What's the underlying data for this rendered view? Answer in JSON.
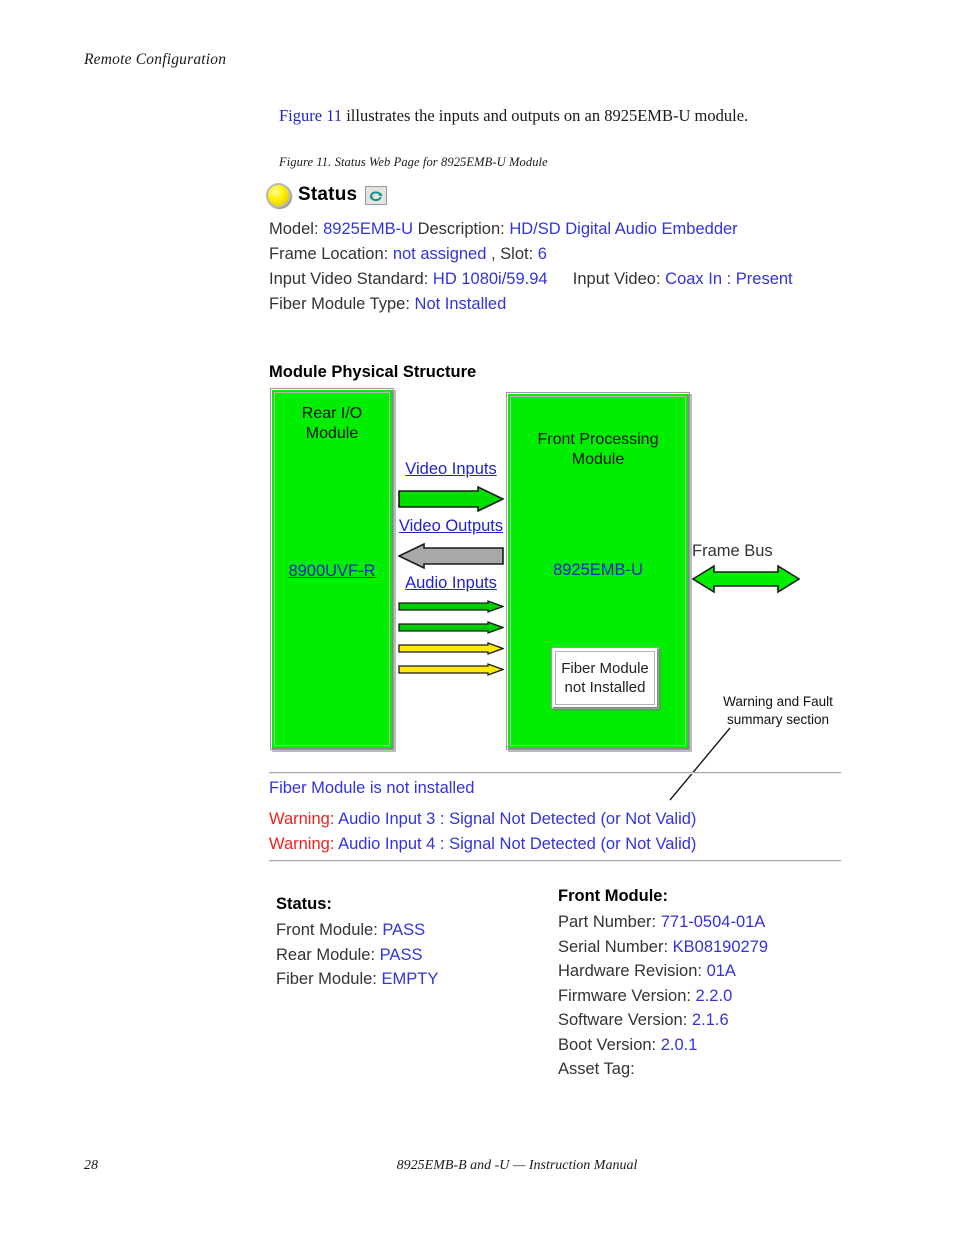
{
  "page": {
    "running_head": "Remote Configuration",
    "body_paragraph_prefix": "Figure 11",
    "body_paragraph_rest": " illustrates the inputs and outputs on an 8925EMB-U module.",
    "figure_caption": "Figure 11.  Status Web Page for 8925EMB-U Module",
    "folio": "28",
    "footer_title": "8925EMB-B and -U — Instruction Manual"
  },
  "status_panel": {
    "led_icon": "yellow-led-icon",
    "heading": "Status",
    "refresh_icon": "refresh-icon",
    "fields": [
      {
        "label": "Model:",
        "value": "8925EMB-U",
        "label2": "Description:",
        "value2": "HD/SD Digital Audio Embedder"
      },
      {
        "label": "Frame Location:",
        "value": "not assigned",
        "label2": ", Slot:",
        "value2": "6"
      },
      {
        "label": "Input Video Standard:",
        "value": "HD 1080i/59.94",
        "label2": "Input Video:",
        "value2": "Coax In : Present"
      },
      {
        "label": "Fiber Module Type:",
        "value": "Not Installed",
        "label2": "",
        "value2": ""
      }
    ]
  },
  "diagram": {
    "title": "Module Physical Structure",
    "rear_module": {
      "label_line1": "Rear I/O",
      "label_line2": "Module",
      "link": "8900UVF-R"
    },
    "front_module": {
      "label_line1": "Front Processing",
      "label_line2": "Module",
      "link": "8925EMB-U",
      "fiber_sub_line1": "Fiber Module",
      "fiber_sub_line2": "not Installed"
    },
    "arrows": {
      "video_inputs": "Video Inputs",
      "video_outputs": "Video Outputs",
      "audio_inputs": "Audio Inputs",
      "frame_bus": "Frame Bus"
    },
    "callout_line1": "Warning and Fault",
    "callout_line2": "summary section",
    "colors": {
      "module_green": "#00ee00",
      "arrow_green": "#00dd00",
      "arrow_gray": "#a8a8a8",
      "arrow_yellow": "#ffea00",
      "link_blue": "#2222cc"
    }
  },
  "messages": {
    "fiber": "Fiber Module is not installed",
    "warnings": [
      {
        "prefix": "Warning:",
        "text": "Audio Input 3 : Signal Not Detected (or Not Valid)"
      },
      {
        "prefix": "Warning:",
        "text": "Audio Input 4 : Signal Not Detected (or Not Valid)"
      }
    ],
    "warning_color": "#ee2222"
  },
  "status_column": {
    "heading": "Status:",
    "rows": [
      {
        "label": "Front Module:",
        "value": "PASS"
      },
      {
        "label": "Rear Module:",
        "value": "PASS"
      },
      {
        "label": "Fiber Module:",
        "value": "EMPTY"
      }
    ]
  },
  "front_module_column": {
    "heading": "Front Module:",
    "rows": [
      {
        "label": "Part Number:",
        "value": "771-0504-01A"
      },
      {
        "label": "Serial Number:",
        "value": "KB08190279"
      },
      {
        "label": "Hardware Revision:",
        "value": "01A"
      },
      {
        "label": "Firmware Version:",
        "value": "2.2.0"
      },
      {
        "label": "Software Version:",
        "value": "2.1.6"
      },
      {
        "label": "Boot Version:",
        "value": "2.0.1"
      },
      {
        "label": "Asset Tag:",
        "value": ""
      }
    ]
  }
}
